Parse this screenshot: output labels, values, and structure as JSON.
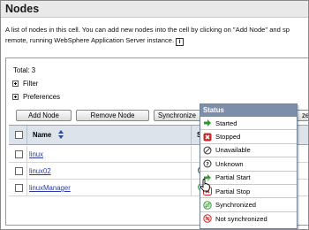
{
  "page": {
    "title": "Nodes",
    "description_line1": "A list of nodes in this cell. You can add new nodes into the cell by clicking on \"Add Node\" and sp",
    "description_line2": "remote, running WebSphere Application Server instance."
  },
  "summary": {
    "total": "Total: 3",
    "filter": "Filter",
    "preferences": "Preferences"
  },
  "toolbar": {
    "add_node": "Add Node",
    "remove_node": "Remove Node",
    "synchronize": "Synchronize",
    "overflow_fragment": "ze"
  },
  "table": {
    "headers": {
      "name": "Name",
      "status": "St"
    },
    "rows": [
      {
        "name": "linux"
      },
      {
        "name": "linux02"
      },
      {
        "name": "linuxManager"
      }
    ]
  },
  "status_legend": {
    "title": "Status",
    "items": [
      {
        "label": "Started",
        "icon": "started-arrow-icon",
        "color": "#2e9a2e"
      },
      {
        "label": "Stopped",
        "icon": "stopped-x-icon",
        "color": "#c62828"
      },
      {
        "label": "Unavailable",
        "icon": "unavailable-icon",
        "color": "#333333"
      },
      {
        "label": "Unknown",
        "icon": "unknown-icon",
        "color": "#333333"
      },
      {
        "label": "Partial Start",
        "icon": "partial-start-icon",
        "color": "#2e9a2e"
      },
      {
        "label": "Partial Stop",
        "icon": "partial-stop-icon",
        "color": "#c62828"
      },
      {
        "label": "Synchronized",
        "icon": "synchronized-icon",
        "color": "#2e9a2e"
      },
      {
        "label": "Not synchronized",
        "icon": "not-synchronized-icon",
        "color": "#c62828"
      }
    ]
  },
  "colors": {
    "link": "#2b3aa8",
    "table_header_bg": "#dde3ea",
    "popup_title_bg": "#7c8ea9"
  }
}
